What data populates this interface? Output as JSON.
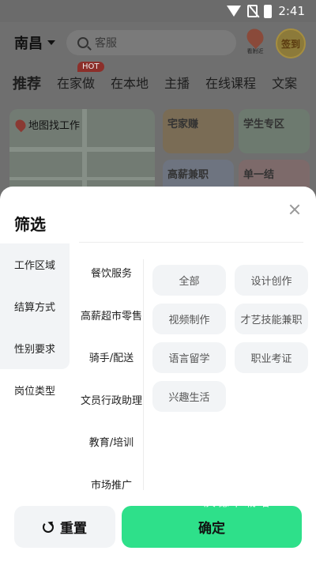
{
  "status_bar": {
    "time": "2:41"
  },
  "header": {
    "city": "南昌",
    "search_placeholder": "客服",
    "map_button_label": "看附近",
    "signin_label": "签到"
  },
  "tabs": [
    {
      "label": "推荐",
      "active": true
    },
    {
      "label": "在家做",
      "badge": "HOT"
    },
    {
      "label": "在本地"
    },
    {
      "label": "主播"
    },
    {
      "label": "在线课程"
    },
    {
      "label": "文案"
    }
  ],
  "cards": {
    "map_label": "地图找工作",
    "card1": "宅家赚",
    "card2": "学生专区",
    "card3": "高薪兼职",
    "card4": "单一结"
  },
  "filter": {
    "title": "筛选",
    "categories": [
      "工作区域",
      "结算方式",
      "性别要求",
      "岗位类型"
    ],
    "job_types": [
      "餐饮服务",
      "高薪超市零售",
      "骑手/配送",
      "文员行政助理",
      "教育/培训",
      "市场推广"
    ],
    "options": [
      "全部",
      "设计创作",
      "视频制作",
      "才艺技能兼职",
      "语言留学",
      "职业考证",
      "兴趣生活"
    ],
    "reset_label": "重置",
    "confirm_label": "确定"
  },
  "watermark": "庆德下载站",
  "colors": {
    "confirm": "#2ee08a",
    "chip_bg": "#f2f4f6",
    "accent_hot": "#8c2f2a"
  }
}
